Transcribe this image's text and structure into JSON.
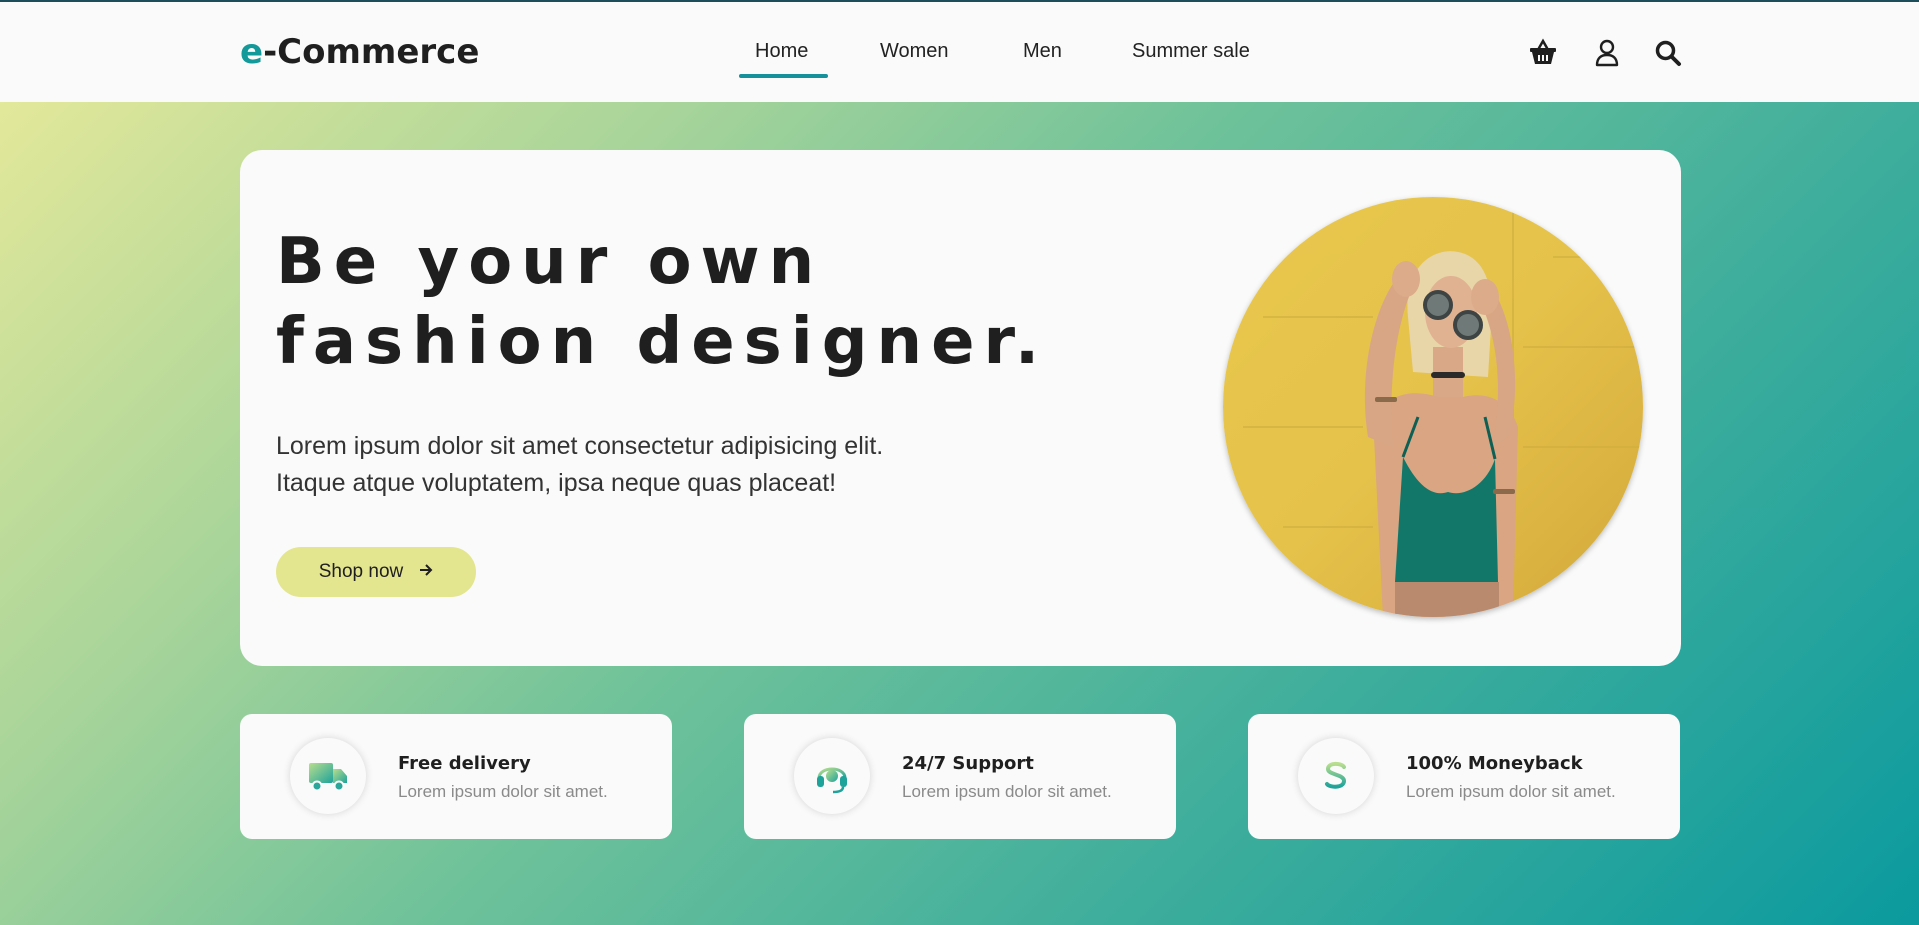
{
  "brand": {
    "prefix": "e",
    "rest": "-Commerce",
    "accent_color": "#14999a"
  },
  "nav": {
    "items": [
      {
        "label": "Home",
        "active": true
      },
      {
        "label": "Women",
        "active": false
      },
      {
        "label": "Men",
        "active": false
      },
      {
        "label": "Summer sale",
        "active": false
      }
    ]
  },
  "header_icons": [
    "basket-icon",
    "user-icon",
    "search-icon"
  ],
  "hero": {
    "headline_line1": "Be your own",
    "headline_line2": "fashion designer.",
    "subtext_line1": "Lorem ipsum dolor sit amet consectetur adipisicing elit.",
    "subtext_line2": "Itaque atque voluptatem, ipsa neque quas placeat!",
    "cta_label": "Shop now",
    "cta_icon": "arrow-right-icon",
    "cta_color": "#e3e58f",
    "image": "woman-in-sunglasses-photo"
  },
  "features": [
    {
      "icon": "truck-icon",
      "title": "Free delivery",
      "desc": "Lorem ipsum dolor sit amet."
    },
    {
      "icon": "headset-icon",
      "title": "24/7 Support",
      "desc": "Lorem ipsum dolor sit amet."
    },
    {
      "icon": "dollar-icon",
      "title": "100% Moneyback",
      "desc": "Lorem ipsum dolor sit amet."
    }
  ],
  "colors": {
    "gradient_start": "#e3e89a",
    "gradient_end": "#0b9a9e",
    "nav_active": "#14919a"
  }
}
